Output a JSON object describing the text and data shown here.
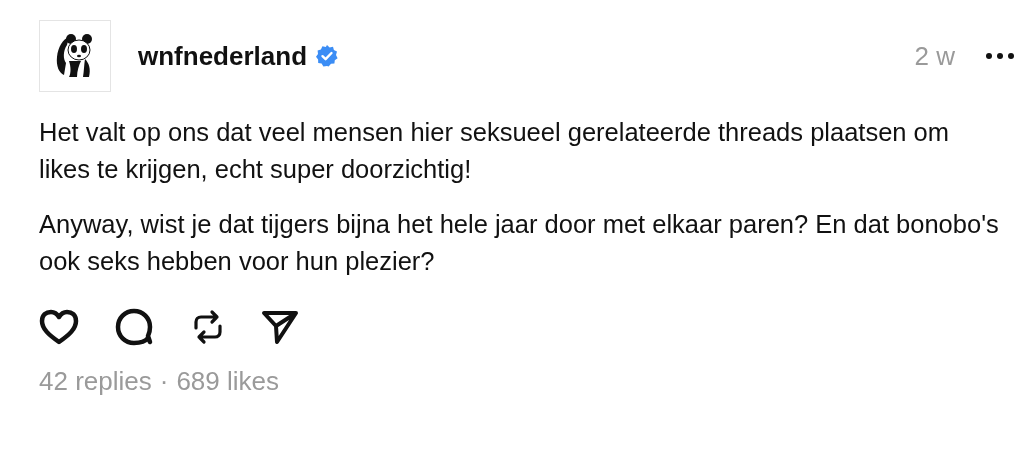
{
  "post": {
    "username": "wnfnederland",
    "verified": true,
    "time": "2 w",
    "paragraphs": [
      "Het valt op ons dat veel mensen hier seksueel gerelateerde threads plaatsen om likes te krijgen, echt super doorzichtig!",
      "Anyway, wist je dat tijgers bijna het hele jaar door met elkaar paren? En dat bonobo's ook seks hebben voor hun plezier?"
    ],
    "replies": "42 replies",
    "separator": "·",
    "likes": "689 likes"
  }
}
